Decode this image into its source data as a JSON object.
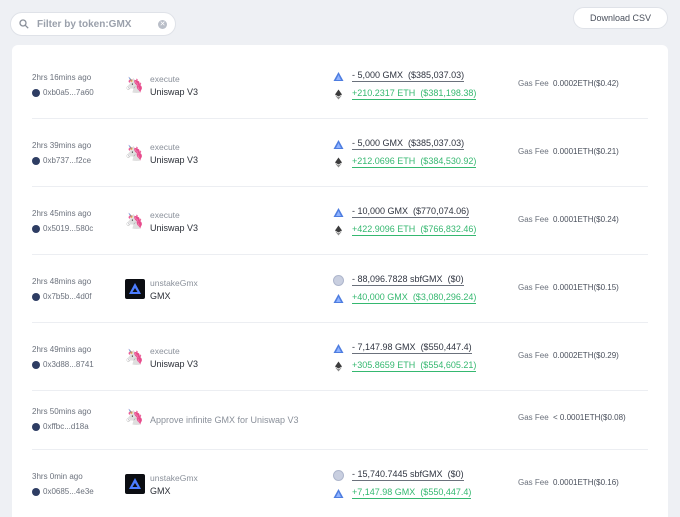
{
  "filter": {
    "placeholder": "Filter by token:GMX",
    "value": "Filter by token:GMX",
    "search_icon": "search-icon",
    "clear_icon": "clear-icon"
  },
  "download": {
    "label": "Download CSV"
  },
  "gas_label": "Gas Fee",
  "transactions": [
    {
      "time": "2hrs 16mins ago",
      "hash": "0xb0a5...7a60",
      "protocol_icon": "uniswap-icon",
      "method": "execute",
      "protocol": "Uniswap V3",
      "tokens": [
        {
          "icon": "arbitrum-icon",
          "amount": "- 5,000 GMX",
          "usd": "($385,037.03)",
          "direction": "out"
        },
        {
          "icon": "ethereum-icon",
          "amount": "+210.2317 ETH",
          "usd": "($381,198.38)",
          "direction": "in"
        }
      ],
      "gas": "0.0002ETH($0.42)"
    },
    {
      "time": "2hrs 39mins ago",
      "hash": "0xb737...f2ce",
      "protocol_icon": "uniswap-icon",
      "method": "execute",
      "protocol": "Uniswap V3",
      "tokens": [
        {
          "icon": "arbitrum-icon",
          "amount": "- 5,000 GMX",
          "usd": "($385,037.03)",
          "direction": "out"
        },
        {
          "icon": "ethereum-icon",
          "amount": "+212.0696 ETH",
          "usd": "($384,530.92)",
          "direction": "in"
        }
      ],
      "gas": "0.0001ETH($0.21)"
    },
    {
      "time": "2hrs 45mins ago",
      "hash": "0x5019...580c",
      "protocol_icon": "uniswap-icon",
      "method": "execute",
      "protocol": "Uniswap V3",
      "tokens": [
        {
          "icon": "arbitrum-icon",
          "amount": "- 10,000 GMX",
          "usd": "($770,074.06)",
          "direction": "out"
        },
        {
          "icon": "ethereum-icon",
          "amount": "+422.9096 ETH",
          "usd": "($766,832.46)",
          "direction": "in"
        }
      ],
      "gas": "0.0001ETH($0.24)"
    },
    {
      "time": "2hrs 48mins ago",
      "hash": "0x7b5b...4d0f",
      "protocol_icon": "gmx-icon",
      "method": "unstakeGmx",
      "protocol": "GMX",
      "tokens": [
        {
          "icon": "sbfgmx-icon",
          "amount": "- 88,096.7828 sbfGMX",
          "usd": "($0)",
          "direction": "out"
        },
        {
          "icon": "arbitrum-icon",
          "amount": "+40,000 GMX",
          "usd": "($3,080,296.24)",
          "direction": "in"
        }
      ],
      "gas": "0.0001ETH($0.15)"
    },
    {
      "time": "2hrs 49mins ago",
      "hash": "0x3d88...8741",
      "protocol_icon": "uniswap-icon",
      "method": "execute",
      "protocol": "Uniswap V3",
      "tokens": [
        {
          "icon": "arbitrum-icon",
          "amount": "- 7,147.98 GMX",
          "usd": "($550,447.4)",
          "direction": "out"
        },
        {
          "icon": "ethereum-icon",
          "amount": "+305.8659 ETH",
          "usd": "($554,605.21)",
          "direction": "in"
        }
      ],
      "gas": "0.0002ETH($0.29)"
    },
    {
      "time": "2hrs 50mins ago",
      "hash": "0xffbc...d18a",
      "protocol_icon": "uniswap-icon",
      "text": "Approve infinite GMX for Uniswap V3",
      "gas": "< 0.0001ETH($0.08)"
    },
    {
      "time": "3hrs 0min ago",
      "hash": "0x0685...4e3e",
      "protocol_icon": "gmx-icon",
      "method": "unstakeGmx",
      "protocol": "GMX",
      "tokens": [
        {
          "icon": "sbfgmx-icon",
          "amount": "- 15,740.7445 sbfGMX",
          "usd": "($0)",
          "direction": "out"
        },
        {
          "icon": "arbitrum-icon",
          "amount": "+7,147.98 GMX",
          "usd": "($550,447.4)",
          "direction": "in"
        }
      ],
      "gas": "0.0001ETH($0.16)"
    }
  ]
}
